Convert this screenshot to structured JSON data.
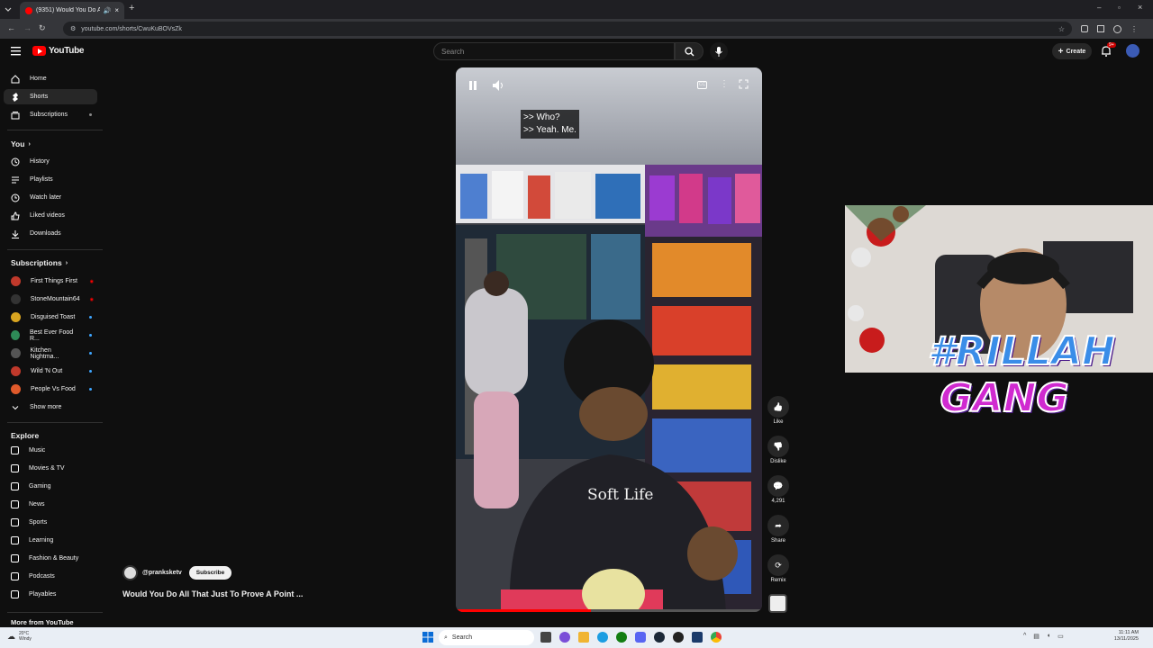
{
  "browser": {
    "tab_title": "(9351) Would You Do All Th",
    "url": "youtube.com/shorts/CwuKuBOVsZk"
  },
  "header": {
    "logo_text": "YouTube",
    "search_placeholder": "Search",
    "create_label": "Create",
    "notifications_count": "9+"
  },
  "sidebar": {
    "main": [
      {
        "label": "Home",
        "icon": "home-icon"
      },
      {
        "label": "Shorts",
        "icon": "shorts-icon"
      },
      {
        "label": "Subscriptions",
        "icon": "subscriptions-icon"
      }
    ],
    "you_header": "You",
    "you": [
      {
        "label": "History",
        "icon": "history-icon"
      },
      {
        "label": "Playlists",
        "icon": "playlists-icon"
      },
      {
        "label": "Watch later",
        "icon": "watch-later-icon"
      },
      {
        "label": "Liked videos",
        "icon": "liked-icon"
      },
      {
        "label": "Downloads",
        "icon": "downloads-icon"
      }
    ],
    "subs_header": "Subscriptions",
    "subscriptions": [
      {
        "label": "First Things First",
        "color": "#c0392b",
        "status": "live"
      },
      {
        "label": "StoneMountain64",
        "color": "#333333",
        "status": "live"
      },
      {
        "label": "Disguised Toast",
        "color": "#d9a520",
        "status": "dot"
      },
      {
        "label": "Best Ever Food R...",
        "color": "#2e8b57",
        "status": "dot"
      },
      {
        "label": "Kitchen Nightma...",
        "color": "#555555",
        "status": "dot"
      },
      {
        "label": "Wild 'N Out",
        "color": "#c0392b",
        "status": "dot"
      },
      {
        "label": "People Vs Food",
        "color": "#e05a2b",
        "status": "dot"
      }
    ],
    "show_more": "Show more",
    "explore_header": "Explore",
    "explore": [
      {
        "label": "Music",
        "icon": "music-icon"
      },
      {
        "label": "Movies & TV",
        "icon": "movies-icon"
      },
      {
        "label": "Gaming",
        "icon": "gaming-icon"
      },
      {
        "label": "News",
        "icon": "news-icon"
      },
      {
        "label": "Sports",
        "icon": "sports-icon"
      },
      {
        "label": "Learning",
        "icon": "learning-icon"
      },
      {
        "label": "Fashion & Beauty",
        "icon": "fashion-icon"
      },
      {
        "label": "Podcasts",
        "icon": "podcasts-icon"
      },
      {
        "label": "Playables",
        "icon": "playables-icon"
      }
    ],
    "more_header": "More from YouTube"
  },
  "short": {
    "caption_line1": ">> Who?",
    "caption_line2": ">> Yeah. Me.",
    "channel": "@pranksketv",
    "subscribe_label": "Subscribe",
    "title": "Would You Do All That Just To Prove A Point ...",
    "shirt_text": "Soft Life",
    "actions": [
      {
        "label": "Like",
        "icon": "like-icon"
      },
      {
        "label": "Dislike",
        "icon": "dislike-icon"
      },
      {
        "label": "4,291",
        "icon": "comment-icon"
      },
      {
        "label": "Share",
        "icon": "share-icon"
      },
      {
        "label": "Remix",
        "icon": "remix-icon"
      }
    ]
  },
  "overlay": {
    "brand_line1": "#RILLAH",
    "brand_line2": "GANG"
  },
  "taskbar": {
    "weather_temp": "20°C",
    "weather_desc": "Windy",
    "search_label": "Search",
    "time": "11:11 AM",
    "date": "13/11/2025"
  }
}
